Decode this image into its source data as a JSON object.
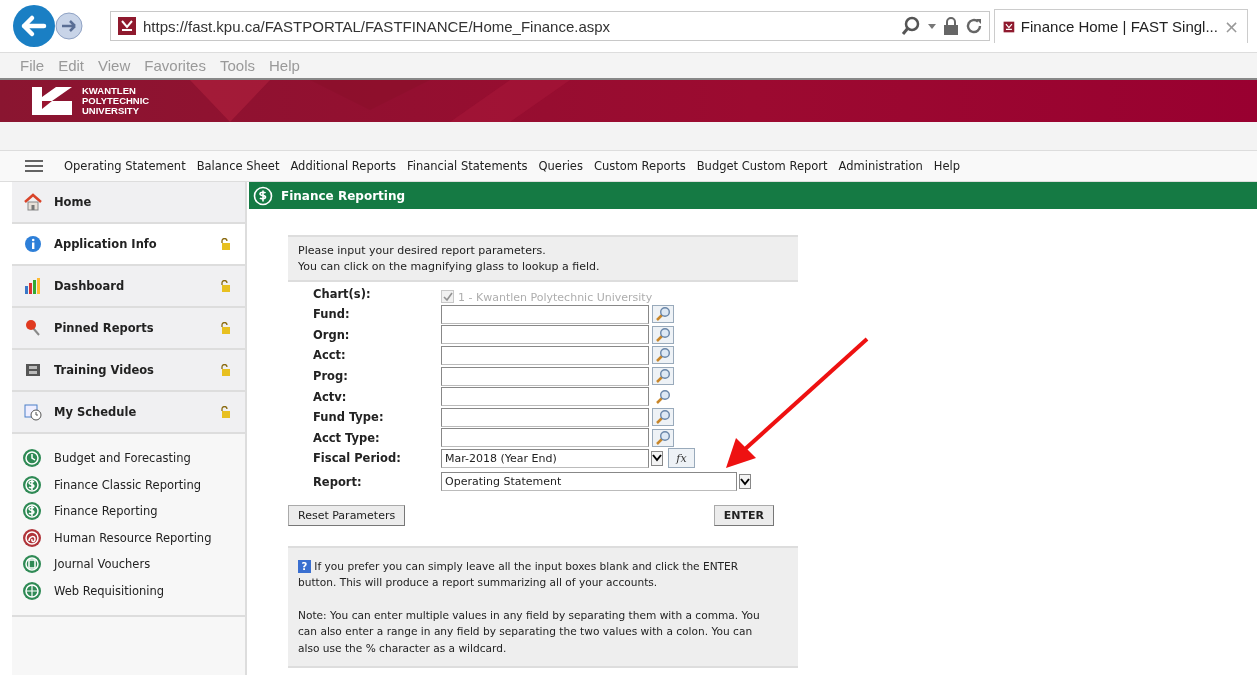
{
  "browser": {
    "url": "https://fast.kpu.ca/FASTPORTAL/FASTFINANCE/Home_Finance.aspx",
    "tab_title": "Finance Home | FAST Singl...",
    "tab_close": "×"
  },
  "menu_bar": [
    "File",
    "Edit",
    "View",
    "Favorites",
    "Tools",
    "Help"
  ],
  "banner": {
    "logo_lines": [
      "KWANTLEN",
      "POLYTECHNIC",
      "UNIVERSITY"
    ]
  },
  "nav": [
    "Operating Statement",
    "Balance Sheet",
    "Additional Reports",
    "Financial Statements",
    "Queries",
    "Custom Reports",
    "Budget Custom Report",
    "Administration",
    "Help"
  ],
  "sidebar": {
    "items": [
      {
        "label": "Home",
        "kind": "home",
        "selected": false,
        "locked": false
      },
      {
        "label": "Application Info",
        "kind": "info",
        "selected": true,
        "locked": true
      },
      {
        "label": "Dashboard",
        "kind": "chart",
        "selected": false,
        "locked": true
      },
      {
        "label": "Pinned Reports",
        "kind": "pin",
        "selected": false,
        "locked": true
      },
      {
        "label": "Training Videos",
        "kind": "film",
        "selected": false,
        "locked": true
      },
      {
        "label": "My Schedule",
        "kind": "calendar",
        "selected": false,
        "locked": true
      }
    ],
    "apps": [
      {
        "label": "Budget and Forecasting",
        "kind": "clock",
        "color": "#2f8a55"
      },
      {
        "label": "Finance Classic Reporting",
        "kind": "dollar",
        "color": "#2f8a55"
      },
      {
        "label": "Finance Reporting",
        "kind": "dollar",
        "color": "#2f8a55"
      },
      {
        "label": "Human Resource Reporting",
        "kind": "swirl",
        "color": "#b0343a"
      },
      {
        "label": "Journal Vouchers",
        "kind": "book",
        "color": "#2f8a55"
      },
      {
        "label": "Web Requisitioning",
        "kind": "globe",
        "color": "#2f8a55"
      }
    ]
  },
  "panel": {
    "title": "Finance Reporting",
    "intro": [
      "Please input your desired report parameters.",
      "You can click on the magnifying glass to lookup a field."
    ],
    "chart": {
      "label": "Chart(s):",
      "value": "1 - Kwantlen Polytechnic University",
      "checked": true,
      "disabled": true
    },
    "fields": [
      {
        "label": "Fund:",
        "kind": "lookup"
      },
      {
        "label": "Orgn:",
        "kind": "lookup"
      },
      {
        "label": "Acct:",
        "kind": "lookup"
      },
      {
        "label": "Prog:",
        "kind": "lookup"
      },
      {
        "label": "Actv:",
        "kind": "lookup_plain"
      },
      {
        "label": "Fund Type:",
        "kind": "lookup"
      },
      {
        "label": "Acct Type:",
        "kind": "lookup"
      },
      {
        "label": "Fiscal Period:",
        "kind": "period",
        "value": "Mar-2018 (Year End)",
        "formula_button": "fx"
      },
      {
        "label": "Report:",
        "kind": "select",
        "value": "Operating Statement"
      }
    ],
    "reset_button": "Reset Parameters",
    "enter_button": "ENTER",
    "help_mark": "?",
    "help": [
      "If you prefer you can simply leave all the input boxes blank and click the ENTER button. This will produce a report summarizing all of your accounts.",
      "Note: You can enter multiple values in any field by separating them with a comma. You can also enter a range in any field by separating the two values with a colon. You can also use the % character as a wildcard."
    ]
  }
}
